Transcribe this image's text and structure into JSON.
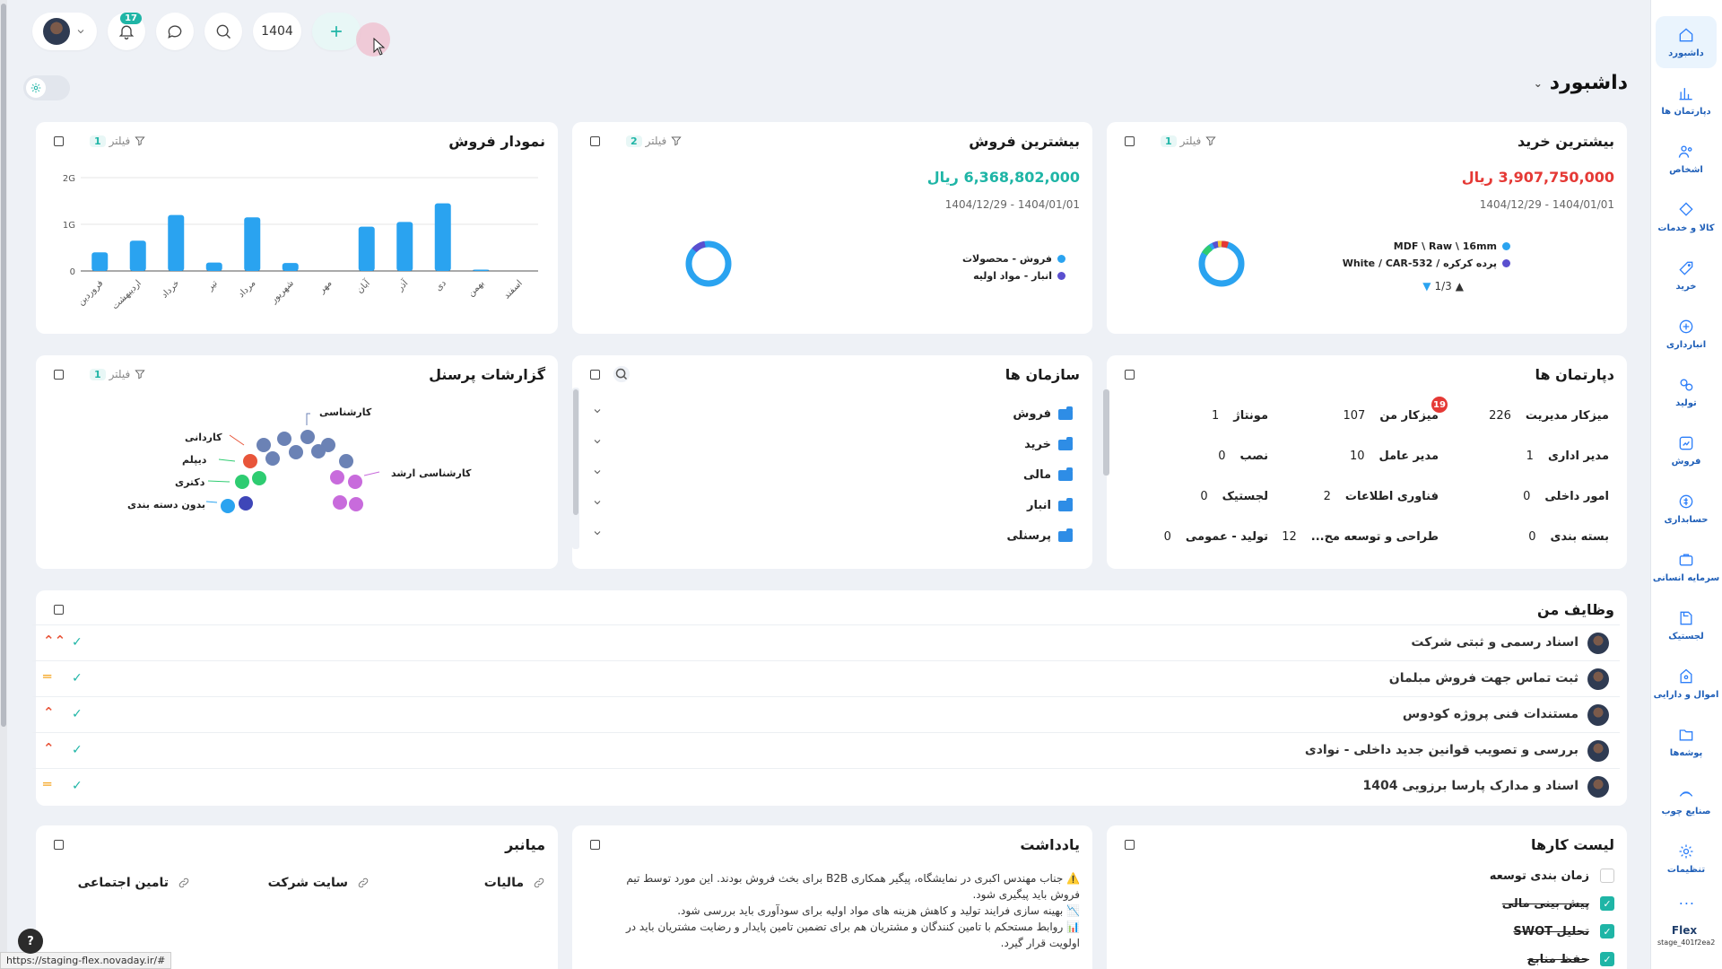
{
  "topbar": {
    "notifications_count": "17",
    "year": "1404"
  },
  "page": {
    "title": "داشبورد"
  },
  "sidebar": {
    "items": [
      {
        "label": "داشبورد",
        "icon": "home-icon"
      },
      {
        "label": "دپارتمان ها",
        "icon": "chart-icon"
      },
      {
        "label": "اشخاص",
        "icon": "people-icon"
      },
      {
        "label": "کالا و خدمات",
        "icon": "box-icon"
      },
      {
        "label": "خرید",
        "icon": "tag-icon"
      },
      {
        "label": "انبارداری",
        "icon": "warehouse-icon"
      },
      {
        "label": "تولید",
        "icon": "factory-icon"
      },
      {
        "label": "فروش",
        "icon": "sales-icon"
      },
      {
        "label": "حسابداری",
        "icon": "dollar-icon"
      },
      {
        "label": "سرمایه انسانی",
        "icon": "briefcase-icon"
      },
      {
        "label": "لجستیک",
        "icon": "truck-icon"
      },
      {
        "label": "اموال و دارایی",
        "icon": "asset-icon"
      },
      {
        "label": "پوشه‌ها",
        "icon": "folder-icon"
      },
      {
        "label": "صنایع چوب",
        "icon": "wood-icon"
      },
      {
        "label": "تنظیمات",
        "icon": "gear-icon"
      }
    ],
    "more": "...",
    "brand": "Flex",
    "build": "stage_401f2ea2"
  },
  "top_buy": {
    "title": "بیشترین خرید",
    "filter_label": "فیلتر",
    "filter_count": "1",
    "amount": "3,907,750,000 ریال",
    "date_range": "1404/12/29 - 1404/01/01",
    "legend": [
      "MDF \\ Raw \\ 16mm",
      "پرده کرکره / White / CAR-532"
    ],
    "pager": "1/3"
  },
  "top_sales": {
    "title": "بیشترین فروش",
    "filter_label": "فیلتر",
    "filter_count": "2",
    "amount": "6,368,802,000 ریال",
    "date_range": "1404/12/29 - 1404/01/01",
    "legend": [
      "فروش - محصولات",
      "انبار - مواد اولیه"
    ]
  },
  "sales_chart": {
    "title": "نمودار فروش",
    "filter_label": "فیلتر",
    "filter_count": "1"
  },
  "chart_data": {
    "type": "bar",
    "categories": [
      "فروردین",
      "اردیبهشت",
      "خرداد",
      "تیر",
      "مرداد",
      "شهریور",
      "مهر",
      "آبان",
      "آذر",
      "دی",
      "بهمن",
      "اسفند"
    ],
    "values": [
      0.4,
      0.65,
      1.2,
      0.18,
      1.15,
      0.17,
      0,
      0.95,
      1.05,
      1.45,
      0.03,
      0
    ],
    "y_ticks": [
      "0",
      "1G",
      "2G"
    ],
    "ylim": [
      0,
      2
    ]
  },
  "departments": {
    "title": "دپارتمان ها",
    "badge": "19",
    "cells": [
      {
        "name": "میزکار مدیریت",
        "count": "226"
      },
      {
        "name": "میزکار من",
        "count": "107"
      },
      {
        "name": "مونتاژ",
        "count": "1"
      },
      {
        "name": "مدیر اداری",
        "count": "1"
      },
      {
        "name": "مدیر عامل",
        "count": "10"
      },
      {
        "name": "نصب",
        "count": "0"
      },
      {
        "name": "امور داخلی",
        "count": "0"
      },
      {
        "name": "فناوری اطلاعات",
        "count": "2"
      },
      {
        "name": "لجستیک",
        "count": "0"
      },
      {
        "name": "بسته بندی",
        "count": "0"
      },
      {
        "name": "طراحی و توسعه مح...",
        "count": "12"
      },
      {
        "name": "تولید - عمومی",
        "count": "0"
      }
    ]
  },
  "org_units": {
    "title": "سازمان ها",
    "items": [
      "فروش",
      "خرید",
      "مالی",
      "انبار",
      "پرسنلی"
    ]
  },
  "personnel": {
    "title": "گزارشات پرسنل",
    "filter_label": "فیلتر",
    "filter_count": "1",
    "labels": [
      "کارشناسی",
      "کاردانی",
      "دیپلم",
      "دکتری",
      "بدون دسته بندی",
      "کارشناسی ارشد"
    ]
  },
  "tasks": {
    "title": "وظایف من",
    "items": [
      {
        "title": "اسناد رسمی و ثبتی شرکت",
        "priority": "high"
      },
      {
        "title": "ثبت تماس جهت فروش مبلمان",
        "priority": "medium"
      },
      {
        "title": "مستندات فنی پروژه کودوس",
        "priority": "up"
      },
      {
        "title": "بررسی و تصویب قوانین جدید داخلی - نوادی",
        "priority": "up"
      },
      {
        "title": "اسناد و مدارک پارسا برزویی 1404",
        "priority": "medium"
      }
    ]
  },
  "shortcuts": {
    "title": "میانبر",
    "items": [
      "مالیات",
      "سایت شرکت",
      "تامین اجتماعی"
    ]
  },
  "notes": {
    "title": "یادداشت",
    "lines": [
      "⚠️ جناب مهندس اکبری در نمایشگاه، پیگیر همکاری B2B برای بخث فروش بودند. این مورد توسط تیم فروش باید پیگیری شود.",
      "📉 بهینه سازی فرایند تولید و کاهش هزینه های مواد اولیه برای سودآوری باید بررسی شود.",
      "📊 روابط مستحکم با تامین کنندگان و مشتریان هم برای تضمین  تامین پایدار و رضایت مشتریان باید در اولویت قرار گیرد."
    ]
  },
  "todo": {
    "title": "لیست کارها",
    "items": [
      {
        "label": "زمان بندی توسعه",
        "done": false
      },
      {
        "label": "پیش بینی مالی",
        "done": true
      },
      {
        "label": "تحلیل SWOT",
        "done": true
      },
      {
        "label": "حفظ منابع",
        "done": true
      }
    ]
  },
  "status_url": "https://staging-flex.novaday.ir/#",
  "help": "?"
}
